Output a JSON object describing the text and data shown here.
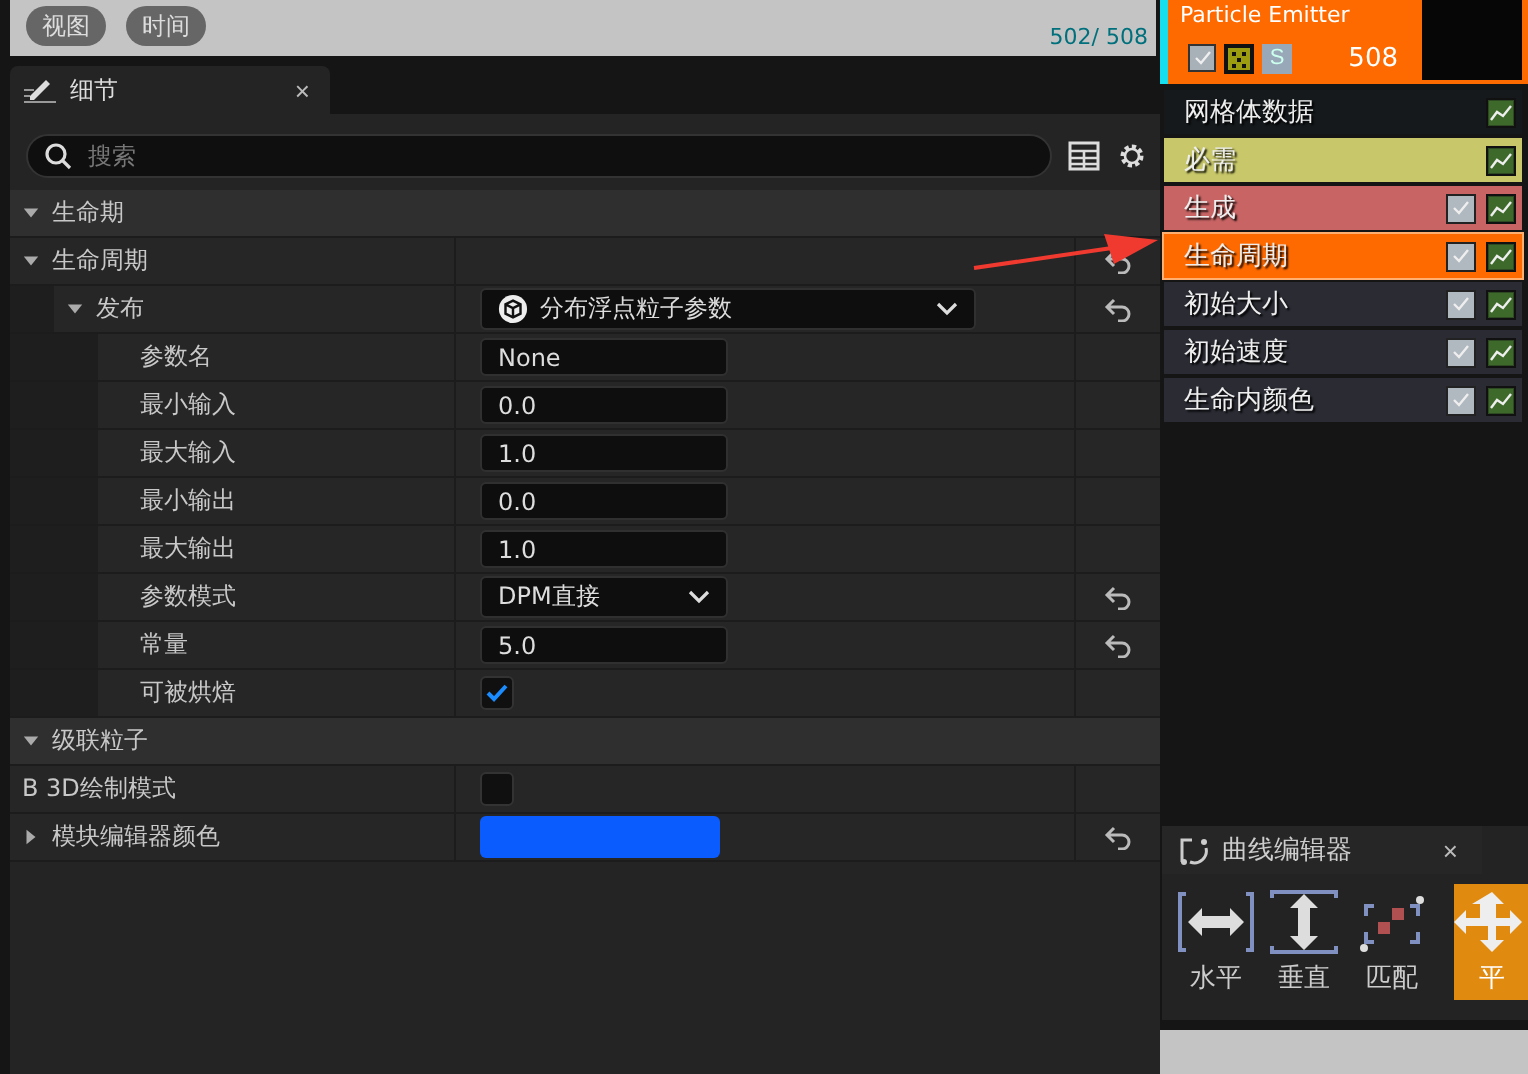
{
  "viewport": {
    "buttons": [
      "视图",
      "时间"
    ],
    "counter": "502/ 508"
  },
  "details_panel": {
    "tab": {
      "label": "细节",
      "close": "×"
    },
    "search": {
      "placeholder": "搜索"
    },
    "categories": [
      {
        "label": "生命期",
        "expanded": true,
        "rows": [
          {
            "label": "生命周期",
            "kind": "group",
            "expanded": true,
            "reset": true,
            "children": [
              {
                "label": "发布",
                "kind": "distribution",
                "value": "分布浮点粒子参数",
                "expanded": true,
                "reset": true,
                "children": [
                  {
                    "label": "参数名",
                    "kind": "text",
                    "value": "None",
                    "reset": false
                  },
                  {
                    "label": "最小输入",
                    "kind": "text",
                    "value": "0.0",
                    "reset": false
                  },
                  {
                    "label": "最大输入",
                    "kind": "text",
                    "value": "1.0",
                    "reset": false
                  },
                  {
                    "label": "最小输出",
                    "kind": "text",
                    "value": "0.0",
                    "reset": false
                  },
                  {
                    "label": "最大输出",
                    "kind": "text",
                    "value": "1.0",
                    "reset": false
                  },
                  {
                    "label": "参数模式",
                    "kind": "dropdown",
                    "value": "DPM直接",
                    "reset": true
                  },
                  {
                    "label": "常量",
                    "kind": "text",
                    "value": "5.0",
                    "reset": true
                  },
                  {
                    "label": "可被烘焙",
                    "kind": "checkbox",
                    "checked": true,
                    "reset": false
                  }
                ]
              }
            ]
          }
        ]
      },
      {
        "label": "级联粒子",
        "expanded": true,
        "rows": [
          {
            "label": "B 3D绘制模式",
            "kind": "checkbox",
            "checked": false,
            "reset": false
          },
          {
            "label": "模块编辑器颜色",
            "kind": "color",
            "color": "#0a5cff",
            "expanded": false,
            "reset": true
          }
        ]
      }
    ]
  },
  "emitter": {
    "name": "Particle Emitter",
    "enabled": true,
    "solo_label": "S",
    "count": "508"
  },
  "modules": [
    {
      "label": "网格体数据",
      "color": "#15191b",
      "kind": "fixed",
      "selected": false
    },
    {
      "label": "必需",
      "color": "#c8c86a",
      "kind": "fixed",
      "selected": false
    },
    {
      "label": "生成",
      "color": "#c86464",
      "kind": "toggle",
      "checked": true,
      "selected": false
    },
    {
      "label": "生命周期",
      "color": "#ff6a00",
      "kind": "toggle",
      "checked": true,
      "selected": true
    },
    {
      "label": "初始大小",
      "color": "#2a2b33",
      "kind": "toggle",
      "checked": true,
      "selected": false
    },
    {
      "label": "初始速度",
      "color": "#2a2b33",
      "kind": "toggle",
      "checked": true,
      "selected": false
    },
    {
      "label": "生命内颜色",
      "color": "#2a2b33",
      "kind": "toggle",
      "checked": true,
      "selected": false
    }
  ],
  "curve_editor": {
    "tab": {
      "label": "曲线编辑器",
      "close": "×"
    },
    "tools": [
      {
        "label": "水平",
        "kind": "horizontal",
        "selected": false
      },
      {
        "label": "垂直",
        "kind": "vertical",
        "selected": false
      },
      {
        "label": "匹配",
        "kind": "fit",
        "selected": false
      },
      {
        "label": "平",
        "kind": "pan",
        "selected": true
      }
    ]
  }
}
